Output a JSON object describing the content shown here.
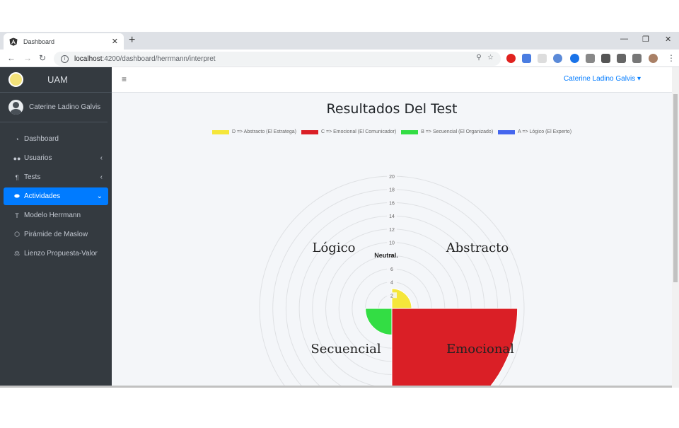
{
  "browser": {
    "tab_title": "Dashboard",
    "url_host": "localhost",
    "url_rest": ":4200/dashboard/herrmann/interpret"
  },
  "sidebar": {
    "brand": "UAM",
    "user_name": "Caterine Ladino Galvis",
    "items": [
      {
        "label": "Dashboard",
        "icon": "tachometer-icon"
      },
      {
        "label": "Usuarios",
        "icon": "users-icon"
      },
      {
        "label": "Tests",
        "icon": "paragraph-icon"
      },
      {
        "label": "Actividades",
        "icon": "gamepad-icon"
      },
      {
        "label": "Modelo Herrmann",
        "icon": "text-height-icon"
      },
      {
        "label": "Pirámide de Maslow",
        "icon": "cubes-icon"
      },
      {
        "label": "Lienzo Propuesta-Valor",
        "icon": "balance-scale-icon"
      }
    ]
  },
  "topbar": {
    "user_menu": "Caterine Ladino Galvis"
  },
  "colors": {
    "sidebar_bg": "#343a40",
    "active": "#007bff",
    "d_abstracto": "#f5e63a",
    "c_emocional": "#da1f26",
    "b_secuencial": "#33dd44",
    "a_logico": "#4466ee"
  },
  "chart_data": {
    "type": "polarArea",
    "title": "Resultados Del Test",
    "legend_position": "top",
    "series": [
      {
        "name": "D => Abstracto (El Estratega)",
        "value": 3,
        "color": "#f5e63a"
      },
      {
        "name": "C => Emocional (El Comunicador)",
        "value": 19,
        "color": "#da1f26"
      },
      {
        "name": "B => Secuencial (El Organizado)",
        "value": 4,
        "color": "#33dd44"
      },
      {
        "name": "A => Lógico (El Experto)",
        "value": 0,
        "color": "#4466ee"
      }
    ],
    "r_range": [
      0,
      20
    ],
    "r_ticks": [
      2,
      4,
      6,
      8,
      10,
      12,
      14,
      16,
      18,
      20
    ],
    "center_label": "Neutral.",
    "quadrant_labels": [
      "Lógico",
      "Abstracto",
      "Secuencial",
      "Emocional"
    ]
  }
}
